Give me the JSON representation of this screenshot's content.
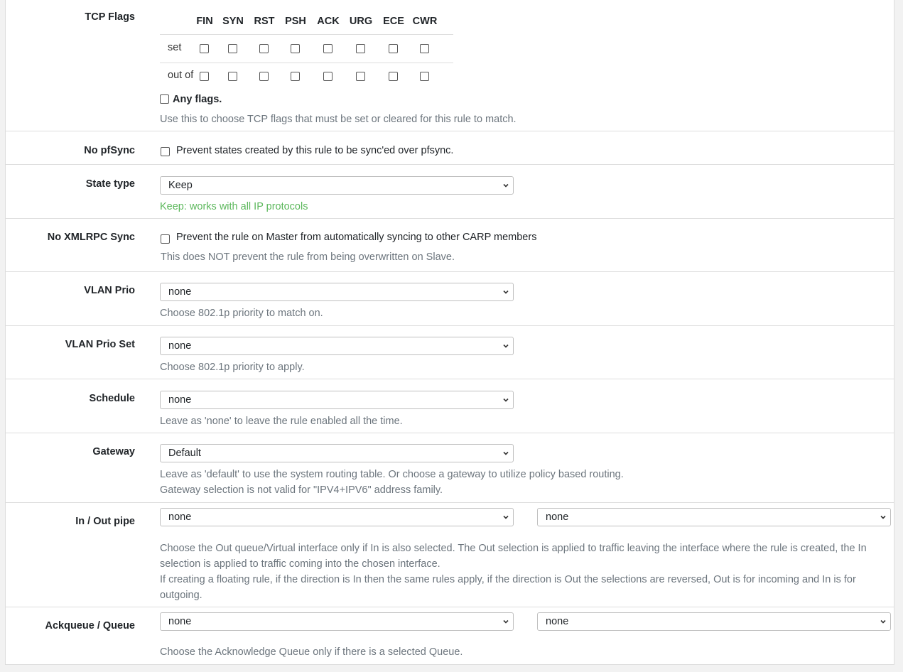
{
  "tcp_flags": {
    "label": "TCP Flags",
    "columns": [
      "FIN",
      "SYN",
      "RST",
      "PSH",
      "ACK",
      "URG",
      "ECE",
      "CWR"
    ],
    "rows": [
      "set",
      "out of"
    ],
    "any_flags_label": "Any flags.",
    "help": "Use this to choose TCP flags that must be set or cleared for this rule to match."
  },
  "no_pfsync": {
    "label": "No pfSync",
    "checkbox_text": "Prevent states created by this rule to be sync'ed over pfsync."
  },
  "state_type": {
    "label": "State type",
    "value": "Keep",
    "help": "Keep: works with all IP protocols"
  },
  "no_xmlrpc": {
    "label": "No XMLRPC Sync",
    "checkbox_text": "Prevent the rule on Master from automatically syncing to other CARP members",
    "help": "This does NOT prevent the rule from being overwritten on Slave."
  },
  "vlan_prio": {
    "label": "VLAN Prio",
    "value": "none",
    "help": "Choose 802.1p priority to match on."
  },
  "vlan_prio_set": {
    "label": "VLAN Prio Set",
    "value": "none",
    "help": "Choose 802.1p priority to apply."
  },
  "schedule": {
    "label": "Schedule",
    "value": "none",
    "help": "Leave as 'none' to leave the rule enabled all the time."
  },
  "gateway": {
    "label": "Gateway",
    "value": "Default",
    "help1": "Leave as 'default' to use the system routing table. Or choose a gateway to utilize policy based routing.",
    "help2": "Gateway selection is not valid for \"IPV4+IPV6\" address family."
  },
  "in_out_pipe": {
    "label": "In / Out pipe",
    "value_in": "none",
    "value_out": "none",
    "help1": "Choose the Out queue/Virtual interface only if In is also selected. The Out selection is applied to traffic leaving the interface where the rule is created, the In selection is applied to traffic coming into the chosen interface.",
    "help2": "If creating a floating rule, if the direction is In then the same rules apply, if the direction is Out the selections are reversed, Out is for incoming and In is for outgoing."
  },
  "ackqueue": {
    "label": "Ackqueue / Queue",
    "value_ack": "none",
    "value_queue": "none",
    "help": "Choose the Acknowledge Queue only if there is a selected Queue."
  },
  "colors": {
    "success": "#5cb85c",
    "help_text": "#6c757d",
    "border": "#dddddd"
  }
}
